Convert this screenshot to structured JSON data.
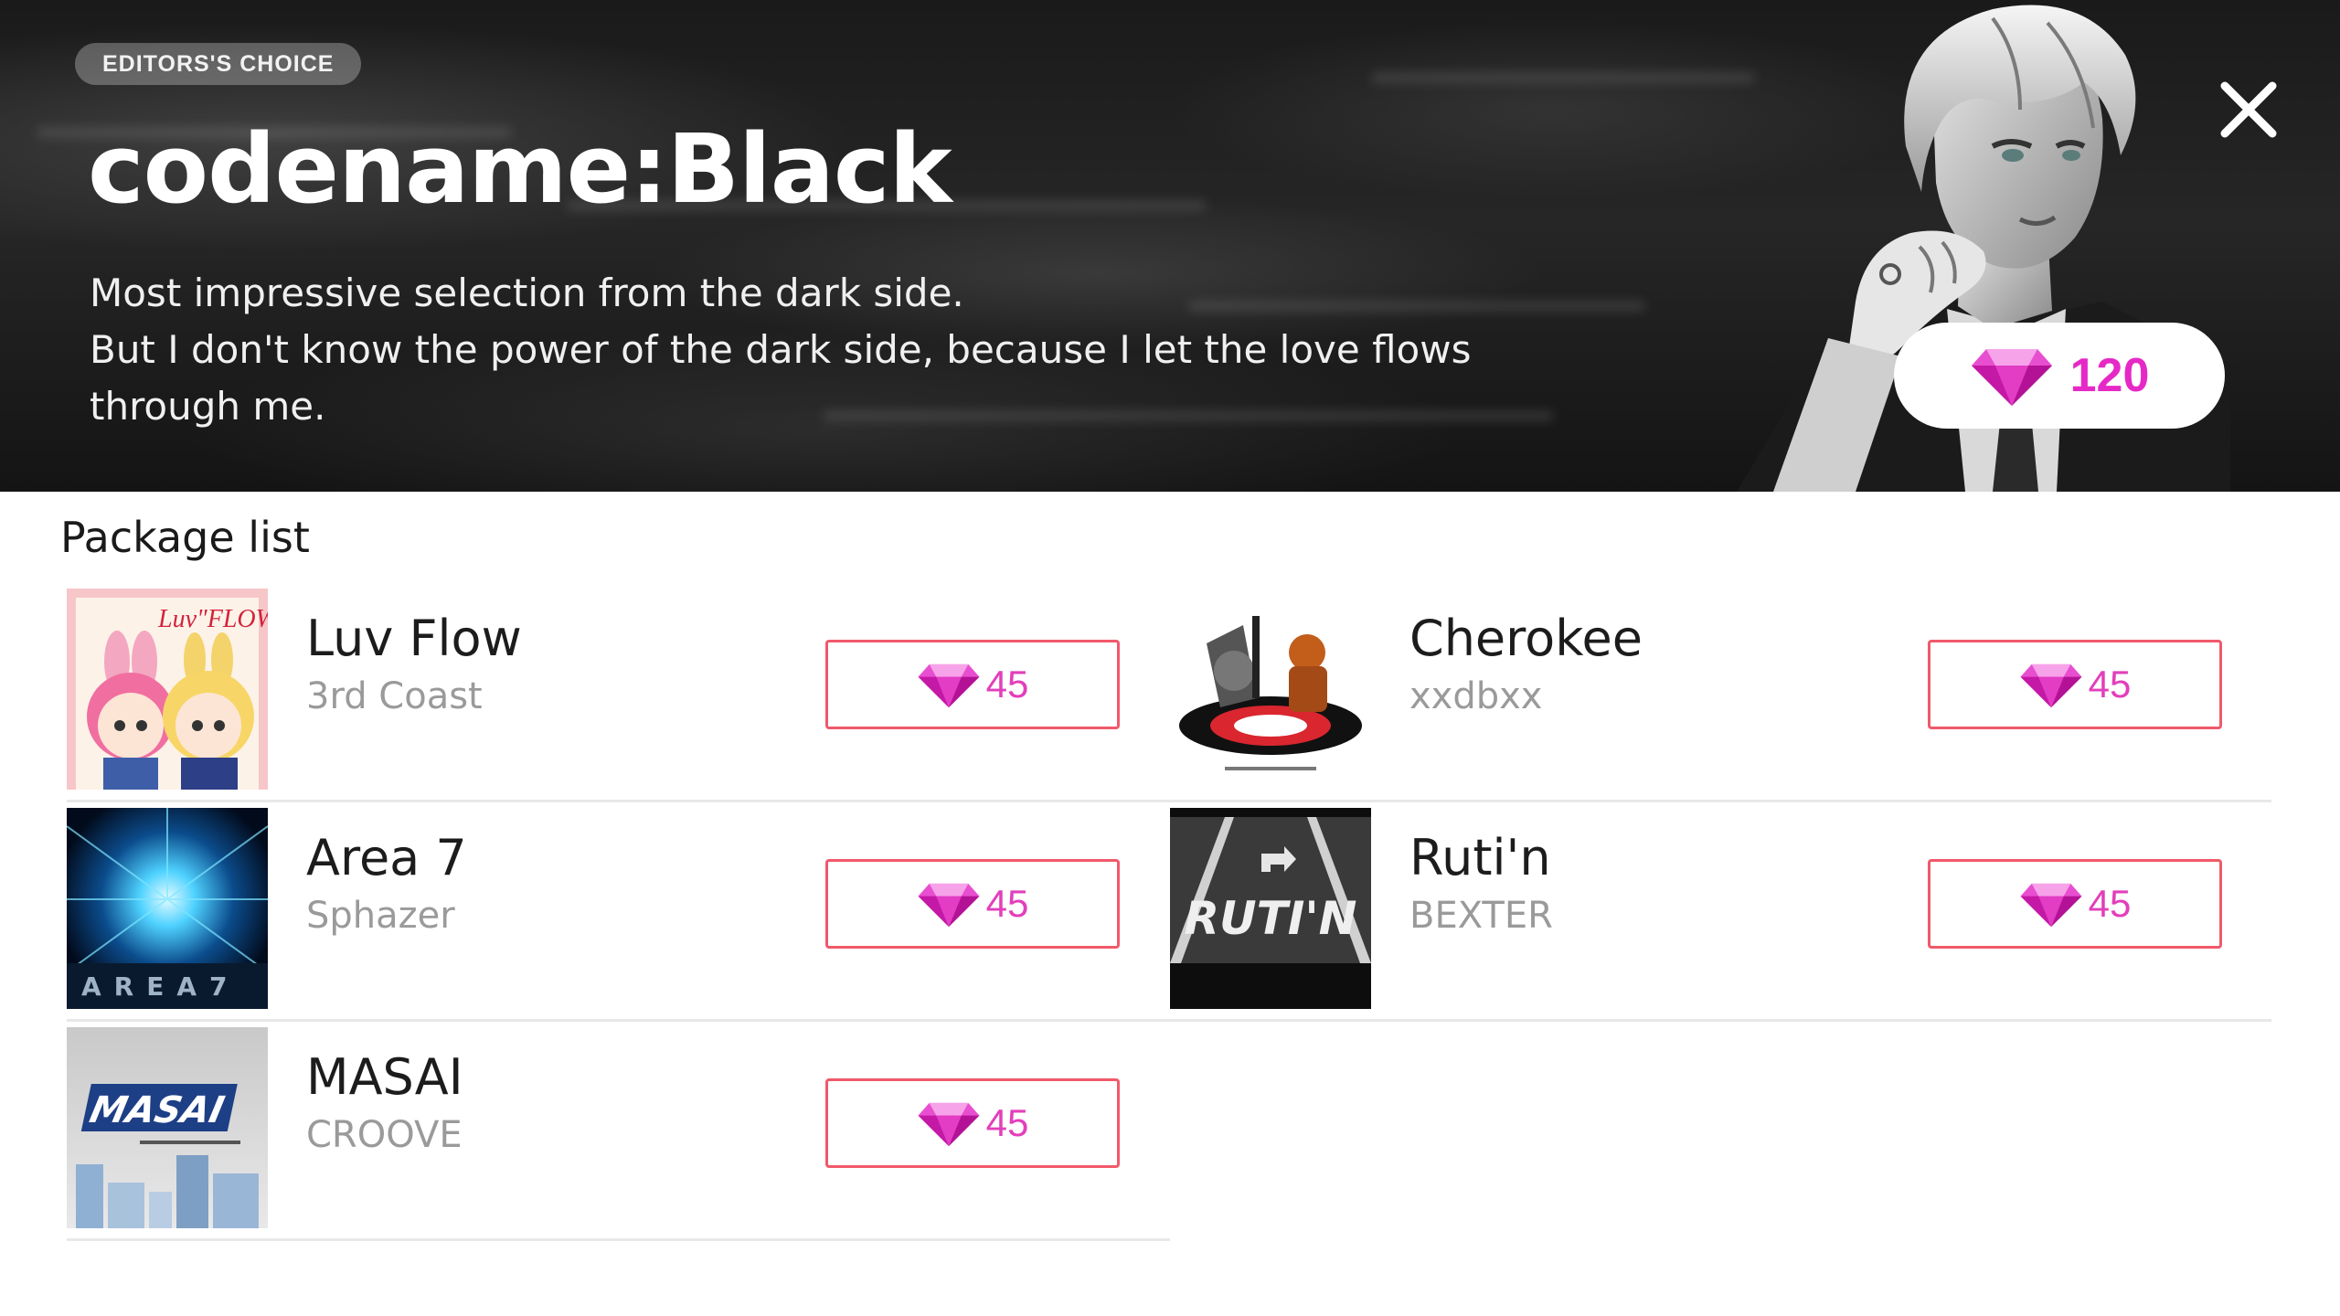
{
  "banner": {
    "badge": "EDITORS'S CHOICE",
    "title": "codename:Black",
    "description_lines": [
      "Most impressive selection from the dark side.",
      "But I don't know the power of the dark side, because I let the love flows",
      "through me."
    ],
    "price": "120",
    "icons": {
      "close": "close-icon",
      "currency": "gem-icon"
    }
  },
  "list": {
    "heading": "Package list",
    "items": [
      {
        "name": "Luv Flow",
        "artist": "3rd Coast",
        "price": "45",
        "cover_text": "Luv\"FLOW"
      },
      {
        "name": "Cherokee",
        "artist": "xxdbxx",
        "price": "45",
        "cover_text": ""
      },
      {
        "name": "Area 7",
        "artist": "Sphazer",
        "price": "45",
        "cover_text": "AREA7"
      },
      {
        "name": "Ruti'n",
        "artist": "BEXTER",
        "price": "45",
        "cover_text": "RUTI'N"
      },
      {
        "name": "MASAI",
        "artist": "CROOVE",
        "price": "45",
        "cover_text": "MASAI"
      }
    ]
  },
  "colors": {
    "accent_pink": "#e629c6",
    "button_border": "#f0596a"
  }
}
